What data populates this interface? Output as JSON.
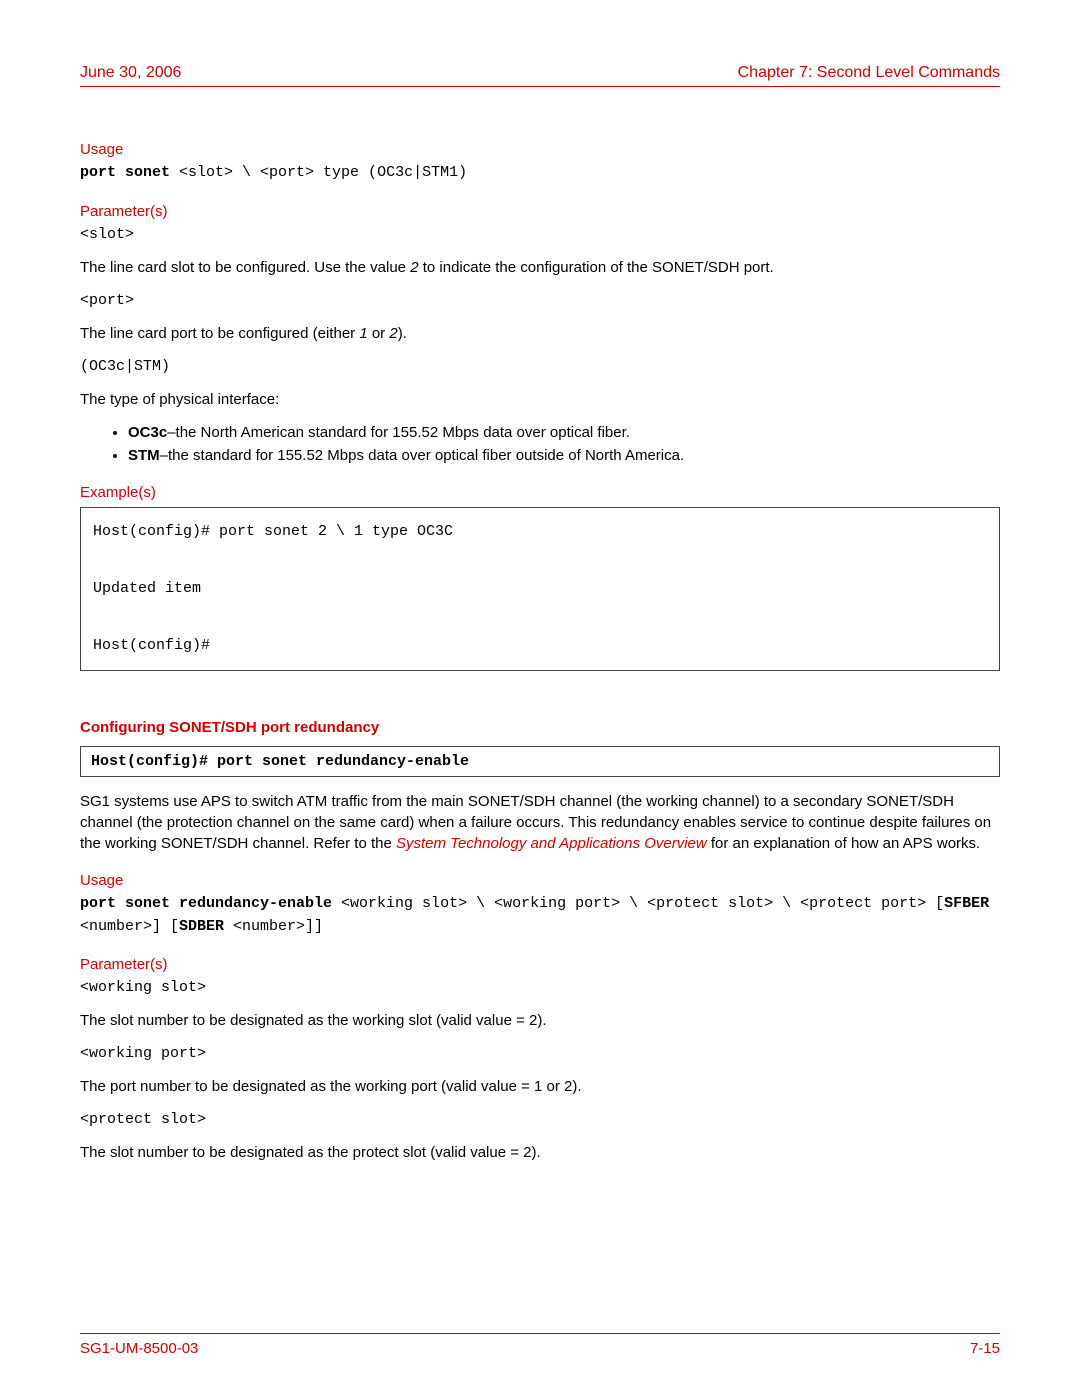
{
  "header": {
    "date": "June 30, 2006",
    "chapter": "Chapter 7: Second Level Commands"
  },
  "section1": {
    "usage_label": "Usage",
    "usage_bold": "port sonet ",
    "usage_rest": "<slot> \\ <port> type (OC3c|STM1)",
    "params_label": "Parameter(s)",
    "p_slot": "<slot>",
    "p_slot_desc_a": "The line card slot to be configured. Use the value ",
    "p_slot_desc_i": "2",
    "p_slot_desc_b": " to indicate the configuration of the SONET/SDH port.",
    "p_port": "<port>",
    "p_port_desc_a": "The line card port to be configured (either ",
    "p_port_desc_i1": "1",
    "p_port_desc_m": " or ",
    "p_port_desc_i2": "2",
    "p_port_desc_b": ").",
    "p_type": "(OC3c|STM)",
    "p_type_desc": "The type of physical interface:",
    "bullet1_b": "OC3c",
    "bullet1_r": "–the North American standard for 155.52 Mbps data over optical fiber.",
    "bullet2_b": "STM",
    "bullet2_r": "–the standard for 155.52 Mbps data over optical fiber outside of North America.",
    "examples_label": "Example(s)",
    "example_text": "Host(config)# port sonet 2 \\ 1 type OC3C\n\nUpdated item\n\nHost(config)#"
  },
  "section2": {
    "heading": "Configuring SONET/SDH port redundancy",
    "cmd": "Host(config)# port sonet redundancy-enable",
    "desc_a": "SG1 systems use APS to switch ATM traffic from the main SONET/SDH channel (the working channel) to a secondary SONET/SDH channel (the protection channel on the same card) when a failure occurs. This redundancy enables service to continue despite failures on the working SONET/SDH channel. Refer to the ",
    "desc_link": "System Technology and Applications Overview",
    "desc_b": " for an explanation of how an APS works.",
    "usage_label": "Usage",
    "usage_b1": "port sonet redundancy-enable ",
    "usage_r1": "<working slot> \\ <working port> \\ <protect slot> \\ <protect port> [",
    "usage_b2": "SFBER ",
    "usage_r2": "<number>] [",
    "usage_b3": "SDBER ",
    "usage_r3": "<number>]]",
    "params_label": "Parameter(s)",
    "p1": "<working slot>",
    "p1d": "The slot number to be designated as the working slot (valid value = 2).",
    "p2": "<working port>",
    "p2d": "The port number to be designated as the working port (valid value = 1 or 2).",
    "p3": "<protect slot>",
    "p3d": "The slot number to be designated as the protect slot (valid value = 2)."
  },
  "footer": {
    "doc_id": "SG1-UM-8500-03",
    "page": "7-15"
  }
}
